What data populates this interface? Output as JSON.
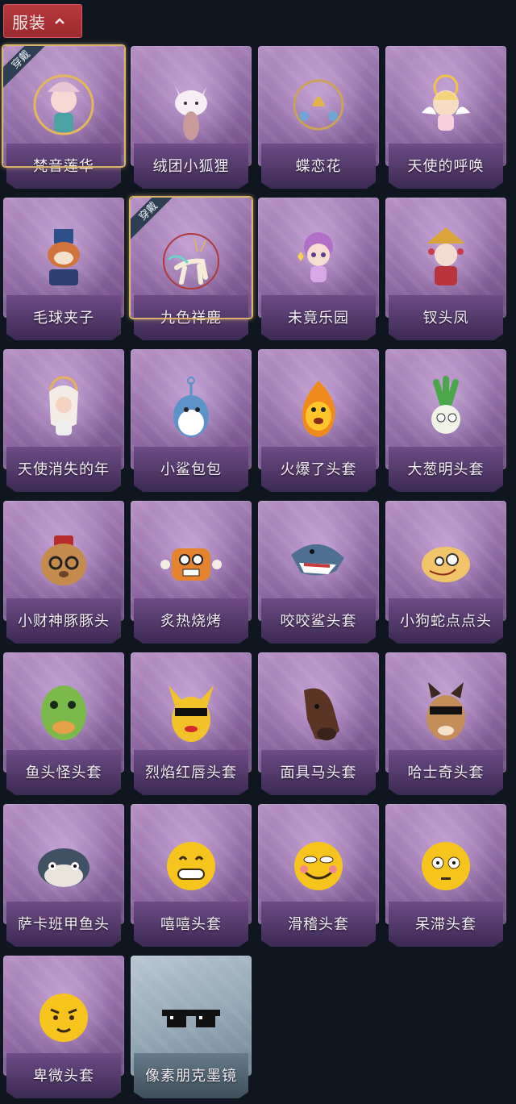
{
  "header": {
    "label": "服装"
  },
  "equipped_tag": "穿戴",
  "items": [
    {
      "name": "梵音莲华",
      "equipped": true
    },
    {
      "name": "绒团小狐狸"
    },
    {
      "name": "蝶恋花"
    },
    {
      "name": "天使的呼唤"
    },
    {
      "name": "毛球夹子"
    },
    {
      "name": "九色祥鹿",
      "equipped": true
    },
    {
      "name": "未竟乐园"
    },
    {
      "name": "钗头凤"
    },
    {
      "name": "天使消失的年"
    },
    {
      "name": "小鲨包包"
    },
    {
      "name": "火爆了头套"
    },
    {
      "name": "大葱明头套"
    },
    {
      "name": "小财神豚豚头"
    },
    {
      "name": "炙热烧烤"
    },
    {
      "name": "咬咬鲨头套"
    },
    {
      "name": "小狗蛇点点头"
    },
    {
      "name": "鱼头怪头套"
    },
    {
      "name": "烈焰红唇头套"
    },
    {
      "name": "面具马头套"
    },
    {
      "name": "哈士奇头套"
    },
    {
      "name": "萨卡班甲鱼头"
    },
    {
      "name": "嘻嘻头套"
    },
    {
      "name": "滑稽头套"
    },
    {
      "name": "呆滞头套"
    },
    {
      "name": "卑微头套"
    },
    {
      "name": "像素朋克墨镜",
      "variant": "grey"
    }
  ],
  "colors": {
    "background": "#0f1620",
    "card_purple": "#8f6aa3",
    "card_grey": "#8fa4b3",
    "equipped_frame": "#d9b26a",
    "header_red": "#b8393c"
  }
}
